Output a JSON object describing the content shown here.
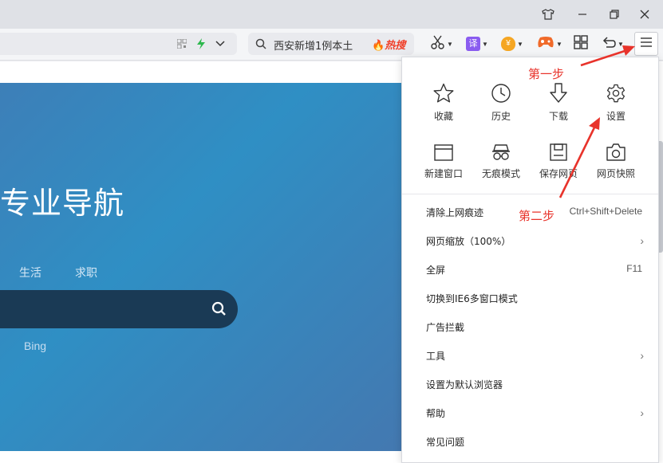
{
  "search": {
    "query": "西安新增1例本土",
    "hot_label": "热搜"
  },
  "hero": {
    "title": "专业导航",
    "tabs": [
      "生活",
      "求职"
    ],
    "engine": "Bing"
  },
  "menu": {
    "grid": [
      {
        "label": "收藏",
        "icon": "star-icon"
      },
      {
        "label": "历史",
        "icon": "clock-icon"
      },
      {
        "label": "下载",
        "icon": "download-icon"
      },
      {
        "label": "设置",
        "icon": "gear-icon"
      },
      {
        "label": "新建窗口",
        "icon": "window-icon"
      },
      {
        "label": "无痕模式",
        "icon": "incognito-icon"
      },
      {
        "label": "保存网页",
        "icon": "save-icon"
      },
      {
        "label": "网页快照",
        "icon": "camera-icon"
      }
    ],
    "items": [
      {
        "label": "清除上网痕迹",
        "shortcut": "Ctrl+Shift+Delete"
      },
      {
        "label": "网页缩放（100%）",
        "submenu": true
      },
      {
        "label": "全屏",
        "shortcut": "F11"
      },
      {
        "label": "切换到IE6多窗口模式"
      },
      {
        "label": "广告拦截"
      },
      {
        "label": "工具",
        "submenu": true
      },
      {
        "label": "设置为默认浏览器"
      },
      {
        "label": "帮助",
        "submenu": true
      },
      {
        "label": "常见问题"
      }
    ],
    "arrow_glyph": "›"
  },
  "annotations": {
    "step1": "第一步",
    "step2": "第二步"
  },
  "colors": {
    "annotation": "#e8332b",
    "hero": "#2f8fc4",
    "hero_search": "#1a3a55"
  }
}
